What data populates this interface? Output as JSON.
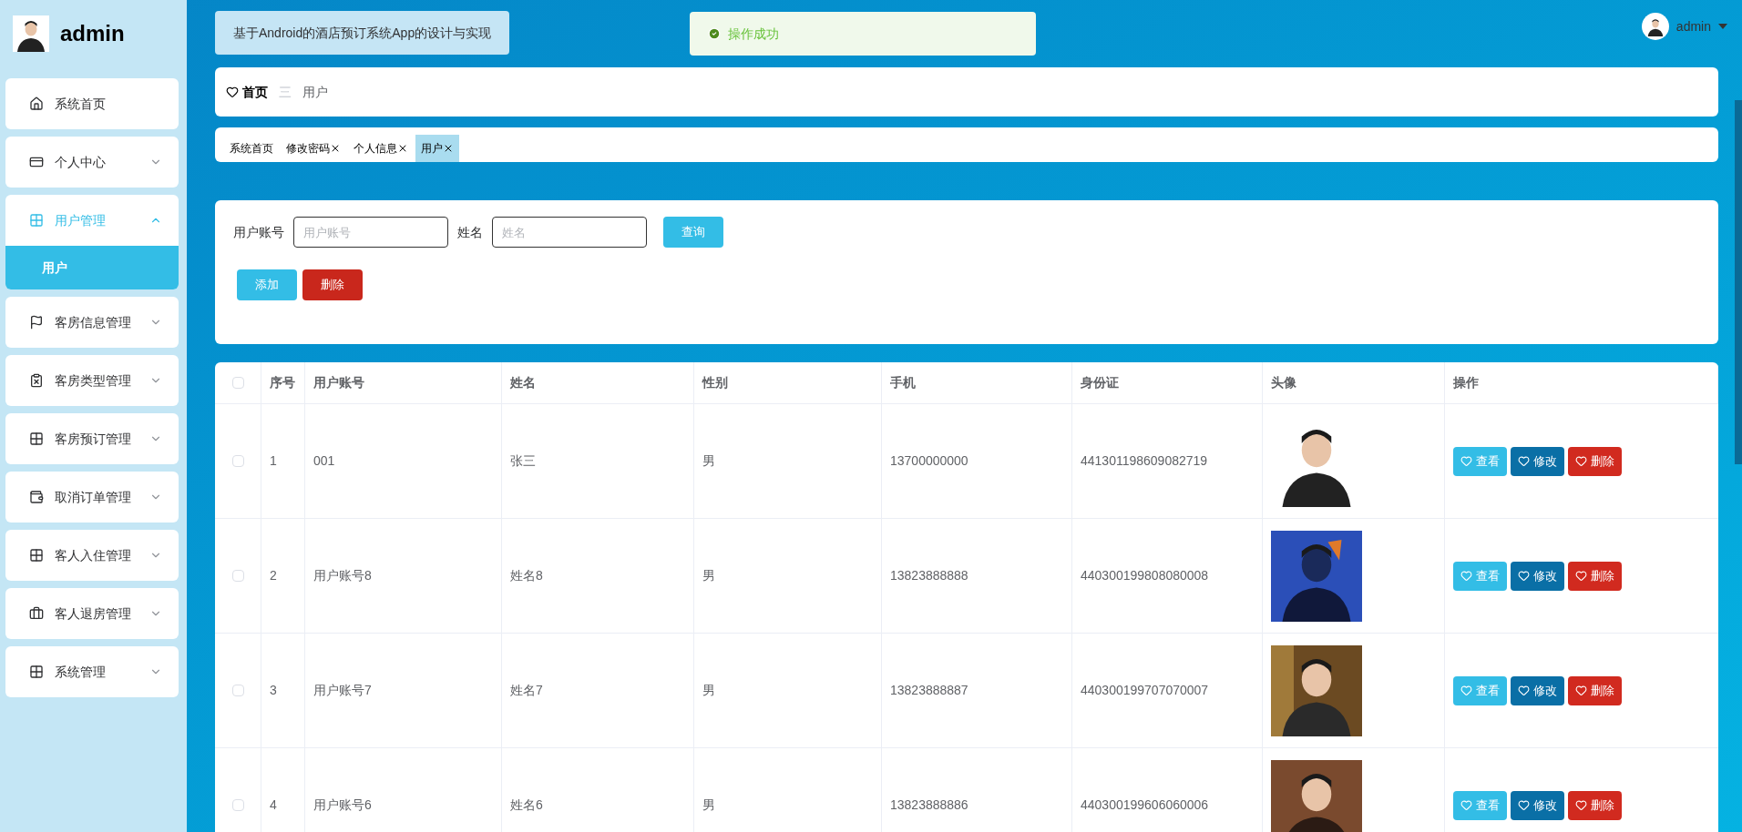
{
  "sidebar": {
    "title": "admin",
    "logo": {
      "kind": "picture"
    },
    "items": [
      {
        "label": "系统首页",
        "kind": "link",
        "expanded": false
      },
      {
        "label": "个人中心",
        "kind": "menu",
        "expanded": false
      },
      {
        "label": "用户管理",
        "kind": "menu",
        "expanded": true,
        "children": [
          {
            "label": "用户",
            "selected": true
          }
        ]
      },
      {
        "label": "客房信息管理",
        "kind": "menu",
        "expanded": false
      },
      {
        "label": "客房类型管理",
        "kind": "menu",
        "expanded": false
      },
      {
        "label": "客房预订管理",
        "kind": "menu",
        "expanded": false
      },
      {
        "label": "取消订单管理",
        "kind": "menu",
        "expanded": false
      },
      {
        "label": "客人入住管理",
        "kind": "menu",
        "expanded": false
      },
      {
        "label": "客人退房管理",
        "kind": "menu",
        "expanded": false
      },
      {
        "label": "系统管理",
        "kind": "menu",
        "expanded": false
      }
    ]
  },
  "header": {
    "title": "基于Android的酒店预订系统App的设计与实现",
    "toast": "操作成功",
    "user": "admin"
  },
  "breadcrumb": {
    "home": "首页",
    "separator": "三",
    "current": "用户"
  },
  "tabs": [
    {
      "label": "系统首页",
      "closable": false,
      "selected": false
    },
    {
      "label": "修改密码",
      "closable": true,
      "selected": false
    },
    {
      "label": "个人信息",
      "closable": true,
      "selected": false
    },
    {
      "label": "用户",
      "closable": true,
      "selected": true
    }
  ],
  "search": {
    "fields": [
      {
        "label": "用户账号",
        "placeholder": "用户账号"
      },
      {
        "label": "姓名",
        "placeholder": "姓名"
      }
    ],
    "query_button": "查询",
    "add_button": "添加",
    "delete_button": "删除"
  },
  "table": {
    "columns": [
      "序号",
      "用户账号",
      "姓名",
      "性别",
      "手机",
      "身份证",
      "头像",
      "操作"
    ],
    "header_checked": false,
    "rows": [
      {
        "checked": false,
        "cells": [
          "1",
          "001",
          "张三",
          "男",
          "13700000000",
          "441301198609082719"
        ],
        "avatar": {
          "kind": "picture"
        },
        "actions": [
          {
            "label": "查看",
            "kind": "view"
          },
          {
            "label": "修改",
            "kind": "edit"
          },
          {
            "label": "删除",
            "kind": "delete"
          }
        ]
      },
      {
        "checked": false,
        "cells": [
          "2",
          "用户账号8",
          "姓名8",
          "男",
          "13823888888",
          "440300199808080008"
        ],
        "avatar": {
          "kind": "picture"
        },
        "actions": [
          {
            "label": "查看",
            "kind": "view"
          },
          {
            "label": "修改",
            "kind": "edit"
          },
          {
            "label": "删除",
            "kind": "delete"
          }
        ]
      },
      {
        "checked": false,
        "cells": [
          "3",
          "用户账号7",
          "姓名7",
          "男",
          "13823888887",
          "440300199707070007"
        ],
        "avatar": {
          "kind": "picture"
        },
        "actions": [
          {
            "label": "查看",
            "kind": "view"
          },
          {
            "label": "修改",
            "kind": "edit"
          },
          {
            "label": "删除",
            "kind": "delete"
          }
        ]
      },
      {
        "checked": false,
        "cells": [
          "4",
          "用户账号6",
          "姓名6",
          "男",
          "13823888886",
          "440300199606060006"
        ],
        "avatar": {
          "kind": "picture"
        },
        "actions": [
          {
            "label": "查看",
            "kind": "view"
          },
          {
            "label": "修改",
            "kind": "edit"
          },
          {
            "label": "删除",
            "kind": "delete"
          }
        ]
      }
    ]
  }
}
